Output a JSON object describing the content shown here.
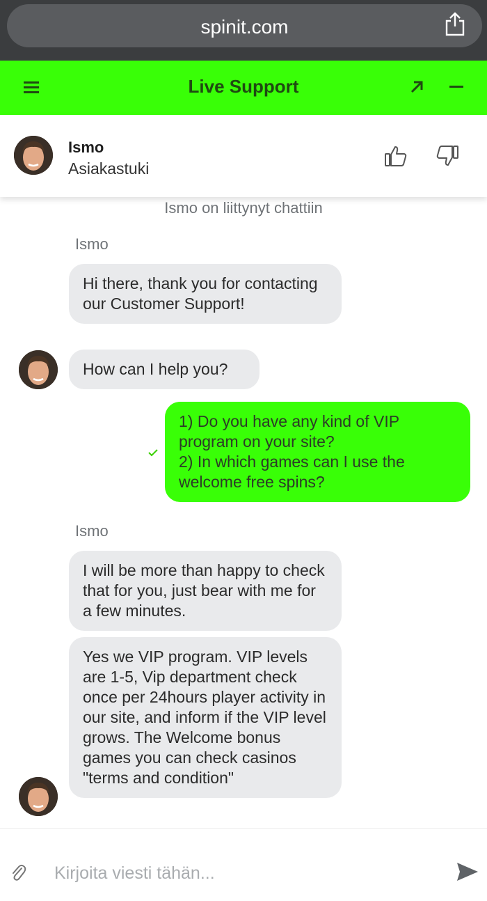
{
  "browser": {
    "url": "spinit.com",
    "share_icon": "share-icon"
  },
  "header": {
    "title": "Live Support",
    "menu_icon": "hamburger-menu-icon",
    "expand_icon": "expand-arrow-icon",
    "minimize_icon": "minimize-icon",
    "accent_color": "#39ff07"
  },
  "agent": {
    "name": "Ismo",
    "role": "Asiakastuki",
    "rate_up_icon": "thumbs-up-icon",
    "rate_down_icon": "thumbs-down-icon"
  },
  "chat": {
    "system_message": "Ismo on liittynyt chattiin",
    "sender_label": "Ismo",
    "messages": [
      {
        "from": "agent",
        "text": "Hi there, thank you for contacting our Customer Support!"
      },
      {
        "from": "agent",
        "text": "How can I help you?"
      },
      {
        "from": "user",
        "text": "1) Do you have any kind of VIP program on your site?\n2) In which games can I use the welcome free spins?"
      },
      {
        "from": "agent",
        "text": "I will be more than happy to check that for you, just bear with me for a few minutes."
      },
      {
        "from": "agent",
        "text": "Yes we VIP program. VIP levels are 1-5, Vip department check once per 24hours player activity in our site, and inform if the VIP level grows. The Welcome bonus games you can check casinos \"terms and condition\""
      }
    ]
  },
  "composer": {
    "placeholder": "Kirjoita viesti tähän...",
    "attach_icon": "paperclip-icon",
    "send_icon": "send-icon"
  }
}
